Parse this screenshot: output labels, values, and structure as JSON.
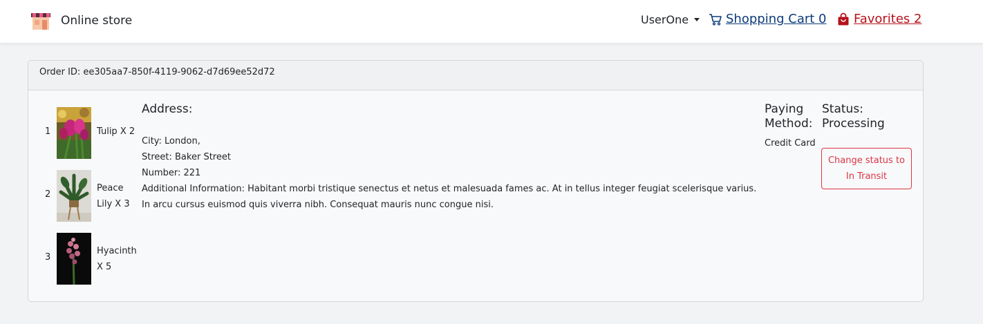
{
  "navbar": {
    "brand": "Online store",
    "user": "UserOne",
    "cart_label": "Shopping Cart 0",
    "favorites_label": "Favorites 2"
  },
  "order": {
    "id_label": "Order ID: ee305aa7-850f-4119-9062-d7d69ee52d72",
    "items": [
      {
        "number": "1",
        "label": "Tulip X 2"
      },
      {
        "number": "2",
        "label": "Peace Lily X 3"
      },
      {
        "number": "3",
        "label": "Hyacinth X 5"
      }
    ],
    "address_title": "Address:",
    "address": {
      "city": "City: London,",
      "street": "Street: Baker Street",
      "number": "Number: 221",
      "additional": "Additional Information: Habitant morbi tristique senectus et netus et malesuada fames ac. At in tellus integer feugiat scelerisque varius. In arcu cursus euismod quis viverra nibh. Consequat mauris nunc congue nisi."
    },
    "paying_title": "Paying Method:",
    "paying_value": "Credit Card",
    "status_title": "Status: Processing",
    "status_button": "Change status to In Transit"
  },
  "colors": {
    "cart_link": "#0d3b7a",
    "favorites_link": "#b5121b",
    "status_button": "#dc3545"
  },
  "icons": {
    "brand": "store-icon",
    "cart": "cart-icon",
    "favorites": "shopping-bag-icon",
    "user_menu": "caret-down-icon"
  }
}
